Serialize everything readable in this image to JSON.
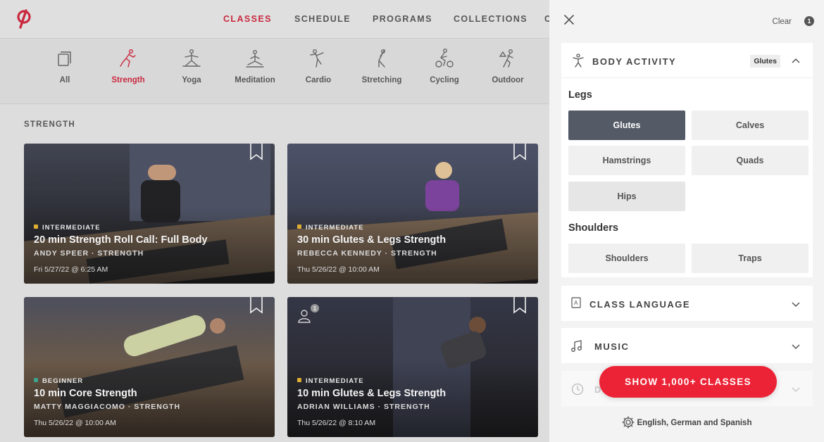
{
  "topnav": {
    "items": [
      {
        "label": "CLASSES",
        "active": true
      },
      {
        "label": "SCHEDULE",
        "active": false
      },
      {
        "label": "PROGRAMS",
        "active": false
      },
      {
        "label": "COLLECTIONS",
        "active": false
      },
      {
        "label": "C",
        "active": false
      }
    ]
  },
  "categories": [
    {
      "label": "All",
      "icon": "stack-icon"
    },
    {
      "label": "Strength",
      "icon": "strength-icon",
      "active": true
    },
    {
      "label": "Yoga",
      "icon": "yoga-icon"
    },
    {
      "label": "Meditation",
      "icon": "meditation-icon"
    },
    {
      "label": "Cardio",
      "icon": "cardio-icon"
    },
    {
      "label": "Stretching",
      "icon": "stretching-icon"
    },
    {
      "label": "Cycling",
      "icon": "cycling-icon"
    },
    {
      "label": "Outdoor",
      "icon": "outdoor-icon"
    }
  ],
  "section_title": "STRENGTH",
  "cards": [
    {
      "level": "INTERMEDIATE",
      "level_color": "#e8b32c",
      "title": "20 min Strength Roll Call: Full Body",
      "instructor": "ANDY SPEER",
      "discipline": "STRENGTH",
      "date": "Fri 5/27/22 @ 6:25 AM"
    },
    {
      "level": "INTERMEDIATE",
      "level_color": "#e8b32c",
      "title": "30 min Glutes & Legs Strength",
      "instructor": "REBECCA KENNEDY",
      "discipline": "STRENGTH",
      "date": "Thu 5/26/22 @ 10:00 AM"
    },
    {
      "level": "BEGINNER",
      "level_color": "#3aa58b",
      "title": "10 min Core Strength",
      "instructor": "MATTY MAGGIACOMO",
      "discipline": "STRENGTH",
      "date": "Thu 5/26/22 @ 10:00 AM"
    },
    {
      "level": "INTERMEDIATE",
      "level_color": "#e8b32c",
      "title": "10 min Glutes & Legs Strength",
      "instructor": "ADRIAN WILLIAMS",
      "discipline": "STRENGTH",
      "date": "Thu 5/26/22 @ 8:10 AM",
      "badge_count": "1"
    }
  ],
  "meta_separator": " · ",
  "panel": {
    "clear_label": "Clear",
    "clear_count": "1",
    "body_activity": {
      "title": "BODY ACTIVITY",
      "selected_tag": "Glutes",
      "groups": [
        {
          "label": "Legs",
          "chips": [
            {
              "label": "Glutes",
              "state": "selected"
            },
            {
              "label": "Calves",
              "state": "normal"
            },
            {
              "label": "Hamstrings",
              "state": "normal"
            },
            {
              "label": "Quads",
              "state": "normal"
            },
            {
              "label": "Hips",
              "state": "hover"
            }
          ]
        },
        {
          "label": "Shoulders",
          "chips": [
            {
              "label": "Shoulders",
              "state": "normal"
            },
            {
              "label": "Traps",
              "state": "normal"
            }
          ]
        }
      ]
    },
    "class_language": {
      "title": "CLASS LANGUAGE"
    },
    "music": {
      "title": "MUSIC"
    },
    "partial_section": {
      "title": "D"
    },
    "show_button": "SHOW 1,000+ CLASSES",
    "language_footer": "English, German and Spanish"
  },
  "colors": {
    "brand_red": "#d2233b",
    "button_red": "#ec2336",
    "selected_chip": "#545a66"
  }
}
